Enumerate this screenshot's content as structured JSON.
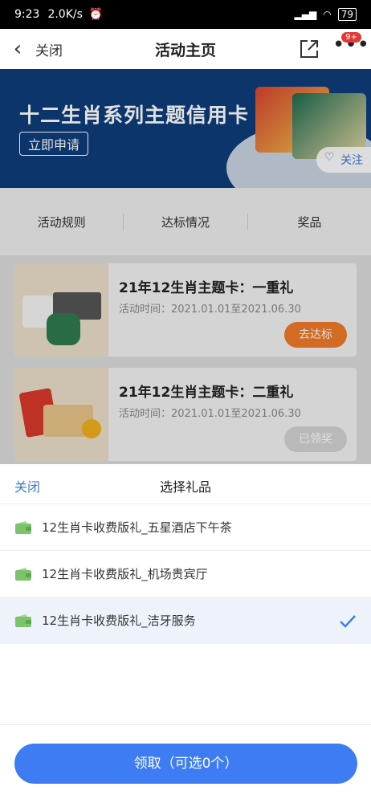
{
  "status_bar": {
    "time": "9:23",
    "speed": "2.0K/s",
    "battery": "79"
  },
  "nav": {
    "close_label": "关闭",
    "title": "活动主页",
    "badge": "9+"
  },
  "banner": {
    "title": "十二生肖系列主题信用卡",
    "apply_label": "立即申请",
    "follow_label": "关注"
  },
  "tabs": [
    "活动规则",
    "达标情况",
    "奖品"
  ],
  "activities": [
    {
      "title": "21年12生肖主题卡：一重礼",
      "time": "活动时间：2021.01.01至2021.06.30",
      "button": "去达标",
      "button_color": "#f07b2a"
    },
    {
      "title": "21年12生肖主题卡：二重礼",
      "time": "活动时间：2021.01.01至2021.06.30",
      "button": "已领奖",
      "button_color": "#d3d3d3"
    }
  ],
  "sheet": {
    "close_label": "关闭",
    "title": "选择礼品",
    "gifts": [
      {
        "label": "12生肖卡收费版礼_五星酒店下午茶",
        "selected": false
      },
      {
        "label": "12生肖卡收费版礼_机场贵宾厅",
        "selected": false
      },
      {
        "label": "12生肖卡收费版礼_洁牙服务",
        "selected": true
      }
    ],
    "claim_label": "领取（可选0个）"
  },
  "colors": {
    "accent": "#3d7cf2",
    "banner": "#0e3d7a",
    "gift_icon": "#7cc46b"
  }
}
